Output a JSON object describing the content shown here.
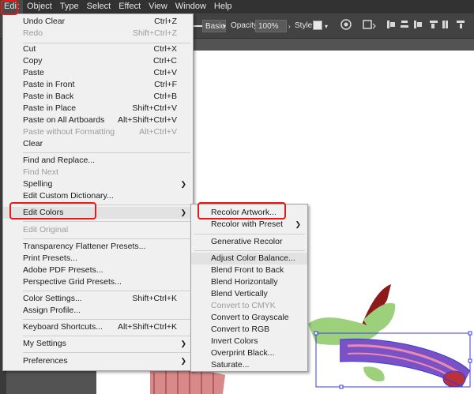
{
  "menubar": {
    "items": [
      "Edit",
      "Object",
      "Type",
      "Select",
      "Effect",
      "View",
      "Window",
      "Help"
    ]
  },
  "controlbar": {
    "brush": "Basic",
    "opacity_label": "Opacity:",
    "opacity_value": "100%",
    "style_label": "Style:"
  },
  "edit_menu": {
    "items": [
      {
        "label": "Undo Clear",
        "shortcut": "Ctrl+Z"
      },
      {
        "label": "Redo",
        "shortcut": "Shift+Ctrl+Z"
      },
      {
        "label": "Cut",
        "shortcut": "Ctrl+X"
      },
      {
        "label": "Copy",
        "shortcut": "Ctrl+C"
      },
      {
        "label": "Paste",
        "shortcut": "Ctrl+V"
      },
      {
        "label": "Paste in Front",
        "shortcut": "Ctrl+F"
      },
      {
        "label": "Paste in Back",
        "shortcut": "Ctrl+B"
      },
      {
        "label": "Paste in Place",
        "shortcut": "Shift+Ctrl+V"
      },
      {
        "label": "Paste on All Artboards",
        "shortcut": "Alt+Shift+Ctrl+V"
      },
      {
        "label": "Paste without Formatting",
        "shortcut": "Alt+Ctrl+V"
      },
      {
        "label": "Clear",
        "shortcut": ""
      },
      {
        "label": "Find and Replace...",
        "shortcut": ""
      },
      {
        "label": "Find Next",
        "shortcut": ""
      },
      {
        "label": "Spelling",
        "shortcut": ""
      },
      {
        "label": "Edit Custom Dictionary...",
        "shortcut": ""
      },
      {
        "label": "Edit Colors",
        "shortcut": ""
      },
      {
        "label": "Edit Original",
        "shortcut": ""
      },
      {
        "label": "Transparency Flattener Presets...",
        "shortcut": ""
      },
      {
        "label": "Print Presets...",
        "shortcut": ""
      },
      {
        "label": "Adobe PDF Presets...",
        "shortcut": ""
      },
      {
        "label": "Perspective Grid Presets...",
        "shortcut": ""
      },
      {
        "label": "Color Settings...",
        "shortcut": "Shift+Ctrl+K"
      },
      {
        "label": "Assign Profile...",
        "shortcut": ""
      },
      {
        "label": "Keyboard Shortcuts...",
        "shortcut": "Alt+Shift+Ctrl+K"
      },
      {
        "label": "My Settings",
        "shortcut": ""
      },
      {
        "label": "Preferences",
        "shortcut": ""
      }
    ]
  },
  "edit_colors_menu": {
    "items": [
      {
        "label": "Recolor Artwork..."
      },
      {
        "label": "Recolor with Preset"
      },
      {
        "label": "Generative Recolor"
      },
      {
        "label": "Adjust Color Balance..."
      },
      {
        "label": "Blend Front to Back"
      },
      {
        "label": "Blend Horizontally"
      },
      {
        "label": "Blend Vertically"
      },
      {
        "label": "Convert to CMYK"
      },
      {
        "label": "Convert to Grayscale"
      },
      {
        "label": "Convert to RGB"
      },
      {
        "label": "Invert Colors"
      },
      {
        "label": "Overprint Black..."
      },
      {
        "label": "Saturate..."
      }
    ]
  },
  "colors": {
    "menubar_bg": "#323232",
    "menu_bg": "#f0f0f0",
    "highlight_red": "#e01b1b",
    "disabled_text": "#9b9b9b",
    "artwork_selection": "#3a3ae0"
  },
  "icons": [
    "submenu-arrow-icon",
    "globe-icon",
    "align-icon",
    "distribute-icon",
    "transform-icon"
  ]
}
